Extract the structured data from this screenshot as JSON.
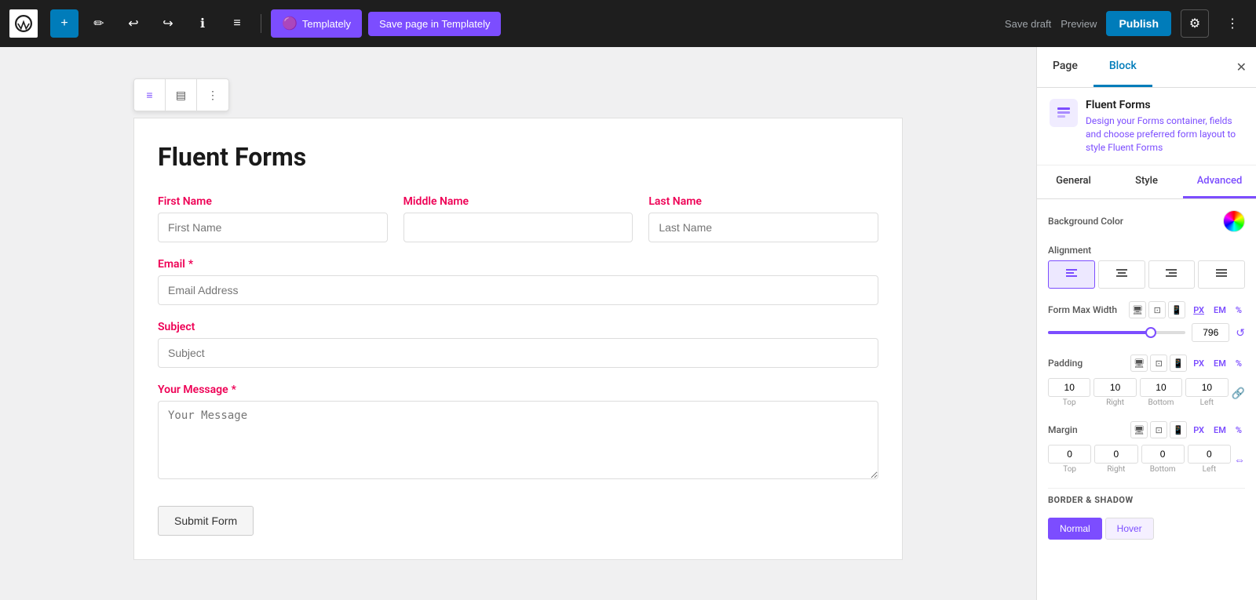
{
  "toolbar": {
    "plus_label": "+",
    "edit_icon": "✏",
    "undo_icon": "↩",
    "redo_icon": "↪",
    "info_icon": "ℹ",
    "menu_icon": "≡",
    "templately_label": "Templately",
    "save_templately_label": "Save page in Templately",
    "save_draft_label": "Save draft",
    "preview_label": "Preview",
    "publish_label": "Publish",
    "settings_icon": "⚙"
  },
  "panel": {
    "tab_page": "Page",
    "tab_block": "Block",
    "close_icon": "✕",
    "block_name": "Fluent Forms",
    "block_desc_pre": "Design your Forms container, fields and choose preferred form layout to style ",
    "block_desc_link": "Fluent Forms",
    "sub_tab_general": "General",
    "sub_tab_style": "Style",
    "sub_tab_advanced": "Advanced",
    "bg_color_label": "Background Color",
    "alignment_label": "Alignment",
    "align_left_icon": "≡",
    "align_center_icon": "≡",
    "align_right_icon": "≡",
    "align_justify_icon": "≡",
    "form_max_width_label": "Form Max Width",
    "desktop_icon": "🖥",
    "tablet_icon": "⊡",
    "mobile_icon": "📱",
    "unit_px": "PX",
    "unit_em": "EM",
    "unit_percent": "%",
    "slider_value": "796",
    "reset_icon": "↺",
    "padding_label": "Padding",
    "padding_top": "10",
    "padding_right": "10",
    "padding_bottom": "10",
    "padding_left": "10",
    "padding_top_label": "Top",
    "padding_right_label": "Right",
    "padding_bottom_label": "Bottom",
    "padding_left_label": "Left",
    "link_icon": "🔗",
    "margin_label": "Margin",
    "margin_top": "0",
    "margin_right": "0",
    "margin_bottom": "0",
    "margin_left": "0",
    "margin_top_label": "Top",
    "margin_right_label": "Right",
    "margin_bottom_label": "Bottom",
    "margin_left_label": "Left",
    "border_shadow_label": "BORDER & SHADOW",
    "normal_label": "Normal",
    "hover_label": "Hover"
  },
  "form": {
    "title": "Fluent Forms",
    "first_name_label": "First Name",
    "first_name_placeholder": "First Name",
    "middle_name_label": "Middle Name",
    "middle_name_placeholder": "",
    "last_name_label": "Last Name",
    "last_name_placeholder": "Last Name",
    "email_label": "Email",
    "email_required": "*",
    "email_placeholder": "Email Address",
    "subject_label": "Subject",
    "subject_placeholder": "Subject",
    "message_label": "Your Message",
    "message_required": "*",
    "message_placeholder": "Your Message",
    "submit_label": "Submit Form"
  },
  "block_toolbar": {
    "align_icon": "≡",
    "layout_icon": "▤",
    "more_icon": "⋮"
  }
}
